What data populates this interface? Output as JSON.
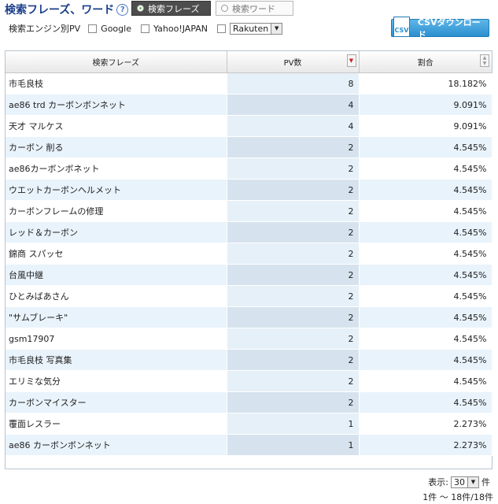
{
  "header": {
    "title": "検索フレーズ、ワード",
    "help_glyph": "?",
    "toggle": {
      "active": "検索フレーズ",
      "inactive": "検索ワード"
    }
  },
  "filters": {
    "label": "検索エンジン別PV",
    "options": [
      "Google",
      "Yahoo!JAPAN"
    ],
    "select_value": "Rakuten"
  },
  "csv_button": {
    "icon_text": "CSV",
    "label": "CSVダウンロード"
  },
  "table": {
    "headers": [
      "検索フレーズ",
      "PV数",
      "割合"
    ],
    "rows": [
      {
        "phrase": "市毛良枝",
        "pv": "8",
        "ratio": "18.182%"
      },
      {
        "phrase": "ae86 trd カーボンボンネット",
        "pv": "4",
        "ratio": "9.091%"
      },
      {
        "phrase": "天才 マルケス",
        "pv": "4",
        "ratio": "9.091%"
      },
      {
        "phrase": "カーボン 削る",
        "pv": "2",
        "ratio": "4.545%"
      },
      {
        "phrase": "ae86カーボンボネット",
        "pv": "2",
        "ratio": "4.545%"
      },
      {
        "phrase": "ウエットカーボンヘルメット",
        "pv": "2",
        "ratio": "4.545%"
      },
      {
        "phrase": "カーボンフレームの修理",
        "pv": "2",
        "ratio": "4.545%"
      },
      {
        "phrase": "レッド＆カーボン",
        "pv": "2",
        "ratio": "4.545%"
      },
      {
        "phrase": "錦商 スパッセ",
        "pv": "2",
        "ratio": "4.545%"
      },
      {
        "phrase": "台風中継",
        "pv": "2",
        "ratio": "4.545%"
      },
      {
        "phrase": "ひとみばあさん",
        "pv": "2",
        "ratio": "4.545%"
      },
      {
        "phrase": "\"サムブレーキ\"",
        "pv": "2",
        "ratio": "4.545%"
      },
      {
        "phrase": "gsm17907",
        "pv": "2",
        "ratio": "4.545%"
      },
      {
        "phrase": "市毛良枝 写真集",
        "pv": "2",
        "ratio": "4.545%"
      },
      {
        "phrase": "エリミな気分",
        "pv": "2",
        "ratio": "4.545%"
      },
      {
        "phrase": "カーボンマイスター",
        "pv": "2",
        "ratio": "4.545%"
      },
      {
        "phrase": "覆面レスラー",
        "pv": "1",
        "ratio": "2.273%"
      },
      {
        "phrase": "ae86 カーボンボンネット",
        "pv": "1",
        "ratio": "2.273%"
      }
    ]
  },
  "pager": {
    "display_label": "表示:",
    "per_page": "30",
    "unit": "件",
    "summary": "1件 〜 18件/18件"
  }
}
